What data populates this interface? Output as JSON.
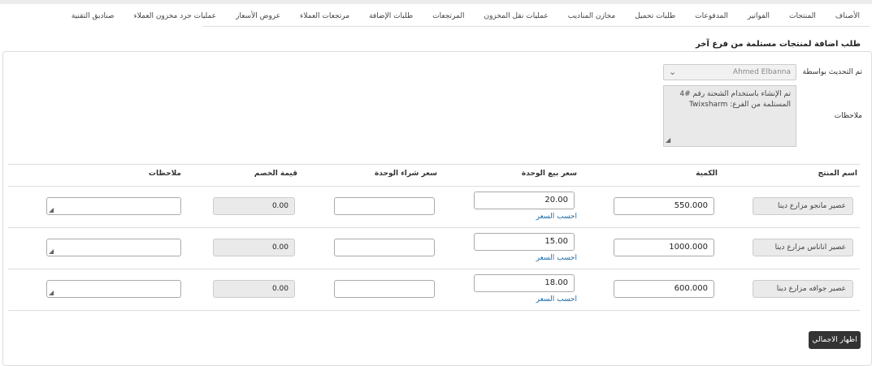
{
  "nav": [
    "الأصناف",
    "المنتجات",
    "الفواتير",
    "المدفوعات",
    "طلبات تحميل",
    "مخازن المناديب",
    "عمليات نقل المخزون",
    "المرتجعات",
    "طلبات الإضافة",
    "مرتجعات العملاء",
    "عروض الأسعار",
    "عمليات جرد مخزون العملاء",
    "صناديق التقنية"
  ],
  "page_title": "طلب اضافة لمنتجات مستلمة من فرع آخر",
  "form": {
    "updated_by_label": "تم التحديث بواسطة",
    "updated_by_value": "Ahmed Elbanna",
    "notes_label": "ملاحظات",
    "notes_value": "تم الإنشاء باستخدام الشحنة رقم #4 المستلمة من الفرع: Twixsharm"
  },
  "table": {
    "headers": {
      "product": "اسم المنتج",
      "qty": "الكمية",
      "unit_sale": "سعر بيع الوحدة",
      "unit_purchase": "سعر شراء الوحدة",
      "discount": "قيمة الخصم",
      "notes": "ملاحظات"
    },
    "calc_link": "احسب السعر",
    "rows": [
      {
        "product": "عصير مانجو مزارع دينا",
        "qty": "550.000",
        "sale": "20.00",
        "purchase": "",
        "discount": "0.00",
        "notes": ""
      },
      {
        "product": "عصير اناناس مزارع دينا",
        "qty": "1000.000",
        "sale": "15.00",
        "purchase": "",
        "discount": "0.00",
        "notes": ""
      },
      {
        "product": "عصير جوافه مزارع دينا",
        "qty": "600.000",
        "sale": "18.00",
        "purchase": "",
        "discount": "0.00",
        "notes": ""
      }
    ]
  },
  "show_total_button": "اظهار الاجمالي"
}
